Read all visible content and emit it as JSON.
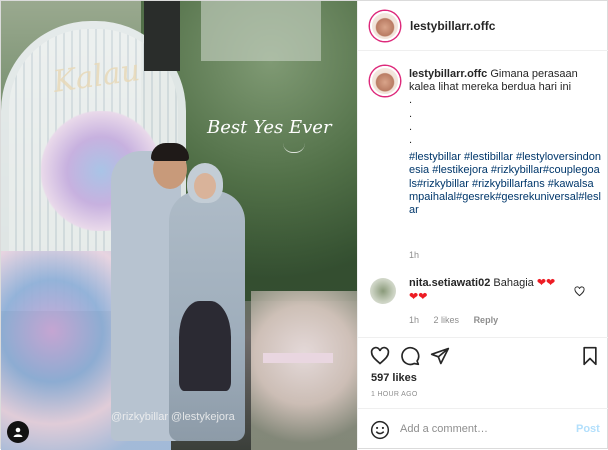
{
  "post": {
    "author": "lestybillarr.offc",
    "caption_text": "Gimana perasaan kalea lihat mereka berdua hari ini",
    "caption_dots": [
      ".",
      ".",
      ".",
      "."
    ],
    "hashtags": "#lestybillar #lestibillar #lestyloversindonesia #lestikejora #rizkybillar#couplegoals#rizkybillar #rizkybillarfans #kawalsampaihalal#gesrek#gesrekuniversal#leslar",
    "caption_time": "1h",
    "likes": "597 likes",
    "posted_ago": "1 HOUR AGO"
  },
  "media": {
    "sign_text": "Kalau",
    "overlay_text": "Best Yes Ever",
    "tags_text": "@rizkybillar @lestykejora"
  },
  "comment": {
    "username": "nita.setiawati02",
    "text": "Bahagia",
    "hearts_inline": "❤❤",
    "hearts_next": "❤❤",
    "time": "1h",
    "likes": "2 likes",
    "reply": "Reply"
  },
  "add_comment": {
    "placeholder": "Add a comment…",
    "post_label": "Post"
  },
  "icons": [
    "user-tag-icon",
    "heart-icon",
    "comment-icon",
    "share-icon",
    "bookmark-icon",
    "emoji-icon",
    "comment-heart-icon"
  ]
}
